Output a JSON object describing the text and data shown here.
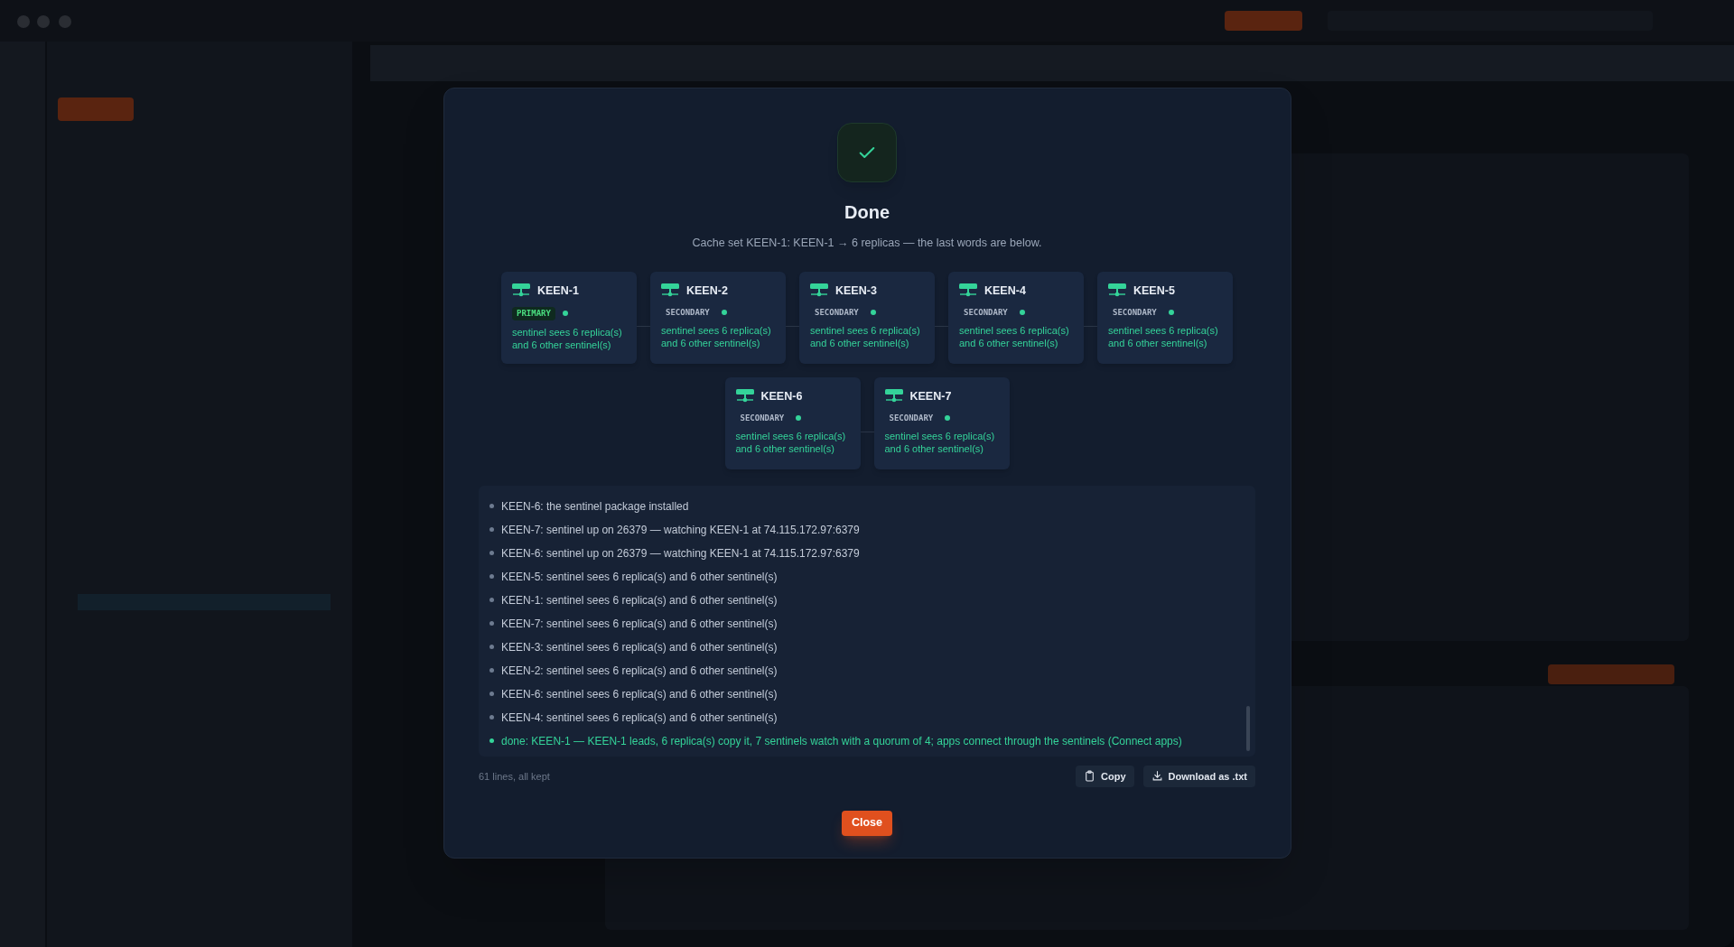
{
  "dialog": {
    "title": "Done",
    "message": "Cache set KEEN-1: KEEN-1 → 6 replicas — the last words are below.",
    "nodes": [
      {
        "name": "KEEN-1",
        "role": "PRIMARY",
        "kind": "primary",
        "color": "#34d399",
        "detail": "sentinel sees 6 replica(s) and 6 other sentinel(s)"
      },
      {
        "name": "KEEN-2",
        "role": "SECONDARY",
        "kind": "secondary",
        "color": "#34d399",
        "detail": "sentinel sees 6 replica(s) and 6 other sentinel(s)"
      },
      {
        "name": "KEEN-3",
        "role": "SECONDARY",
        "kind": "secondary",
        "color": "#34d399",
        "detail": "sentinel sees 6 replica(s) and 6 other sentinel(s)"
      },
      {
        "name": "KEEN-4",
        "role": "SECONDARY",
        "kind": "secondary",
        "color": "#34d399",
        "detail": "sentinel sees 6 replica(s) and 6 other sentinel(s)"
      },
      {
        "name": "KEEN-5",
        "role": "SECONDARY",
        "kind": "secondary",
        "color": "#34d399",
        "detail": "sentinel sees 6 replica(s) and 6 other sentinel(s)"
      },
      {
        "name": "KEEN-6",
        "role": "SECONDARY",
        "kind": "secondary",
        "color": "#34d399",
        "detail": "sentinel sees 6 replica(s) and 6 other sentinel(s)"
      },
      {
        "name": "KEEN-7",
        "role": "SECONDARY",
        "kind": "secondary",
        "color": "#34d399",
        "detail": "sentinel sees 6 replica(s) and 6 other sentinel(s)"
      }
    ],
    "log": [
      {
        "kind": "info",
        "text": "KEEN-6: the sentinel package installed"
      },
      {
        "kind": "info",
        "text": "KEEN-7: sentinel up on 26379 — watching KEEN-1 at 74.115.172.97:6379"
      },
      {
        "kind": "info",
        "text": "KEEN-6: sentinel up on 26379 — watching KEEN-1 at 74.115.172.97:6379"
      },
      {
        "kind": "info",
        "text": "KEEN-5: sentinel sees 6 replica(s) and 6 other sentinel(s)"
      },
      {
        "kind": "info",
        "text": "KEEN-1: sentinel sees 6 replica(s) and 6 other sentinel(s)"
      },
      {
        "kind": "info",
        "text": "KEEN-7: sentinel sees 6 replica(s) and 6 other sentinel(s)"
      },
      {
        "kind": "info",
        "text": "KEEN-3: sentinel sees 6 replica(s) and 6 other sentinel(s)"
      },
      {
        "kind": "info",
        "text": "KEEN-2: sentinel sees 6 replica(s) and 6 other sentinel(s)"
      },
      {
        "kind": "info",
        "text": "KEEN-6: sentinel sees 6 replica(s) and 6 other sentinel(s)"
      },
      {
        "kind": "info",
        "text": "KEEN-4: sentinel sees 6 replica(s) and 6 other sentinel(s)"
      },
      {
        "kind": "done",
        "text": "done: KEEN-1 — KEEN-1 leads, 6 replica(s) copy it, 7 sentinels watch with a quorum of 4; apps connect through the sentinels (Connect apps)"
      }
    ],
    "line_count": "61 lines, all kept",
    "buttons": {
      "copy": "Copy",
      "download": "Download as .txt",
      "close": "Close"
    }
  }
}
